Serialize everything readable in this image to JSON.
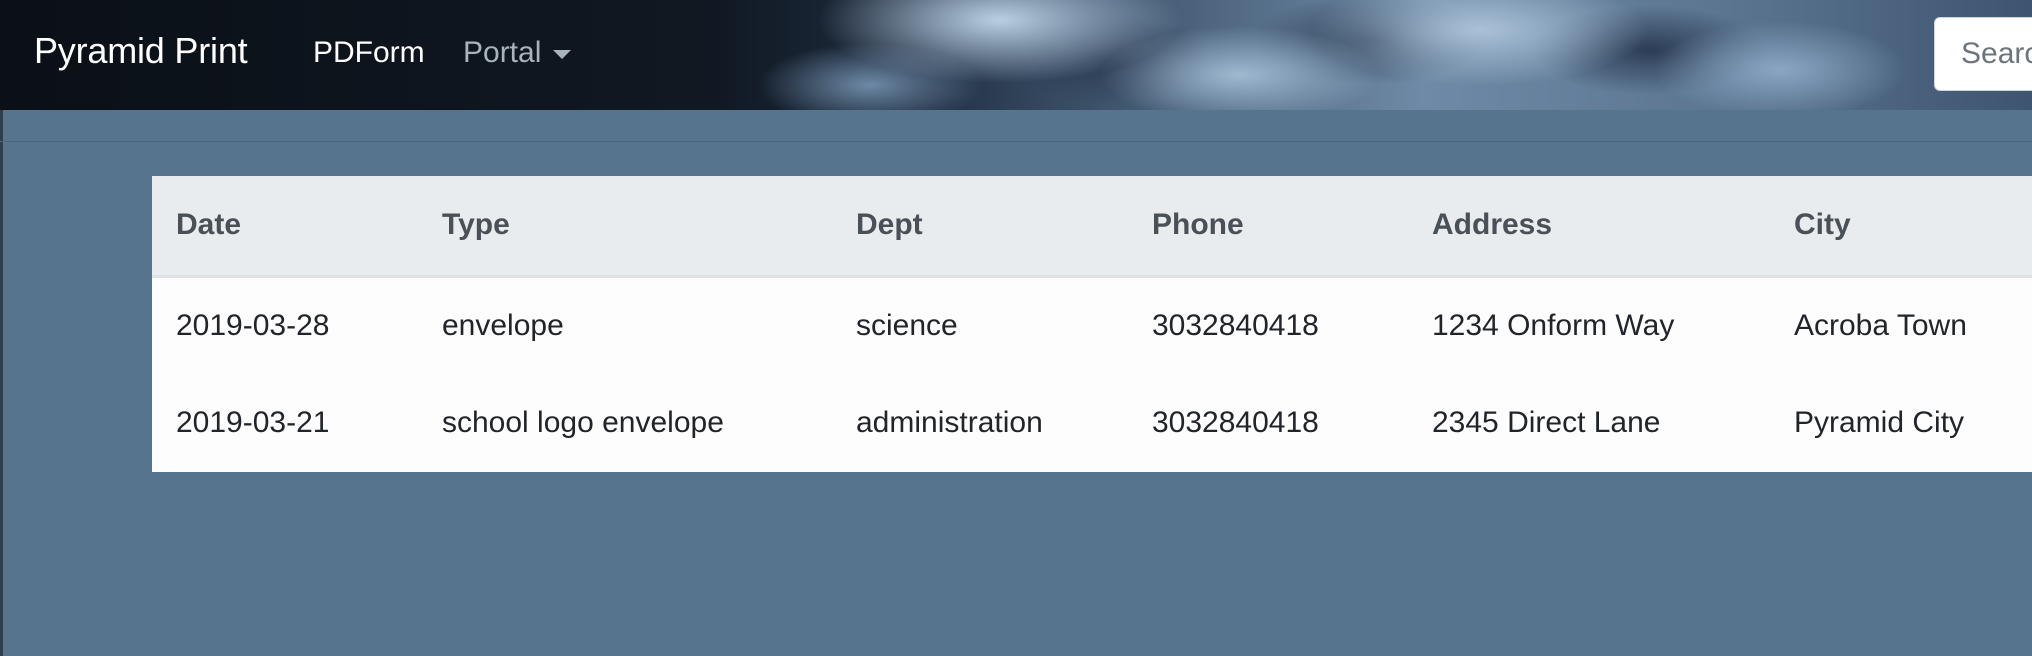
{
  "navbar": {
    "brand": "Pyramid Print",
    "links": [
      "PDForm",
      "Portal"
    ],
    "search_placeholder": "Search"
  },
  "table": {
    "columns": [
      "Date",
      "Type",
      "Dept",
      "Phone",
      "Address",
      "City"
    ],
    "rows": [
      [
        "2019-03-28",
        "envelope",
        "science",
        "3032840418",
        "1234 Onform Way",
        "Acroba Town"
      ],
      [
        "2019-03-21",
        "school logo envelope",
        "administration",
        "3032840418",
        "2345 Direct Lane",
        "Pyramid City"
      ]
    ]
  }
}
